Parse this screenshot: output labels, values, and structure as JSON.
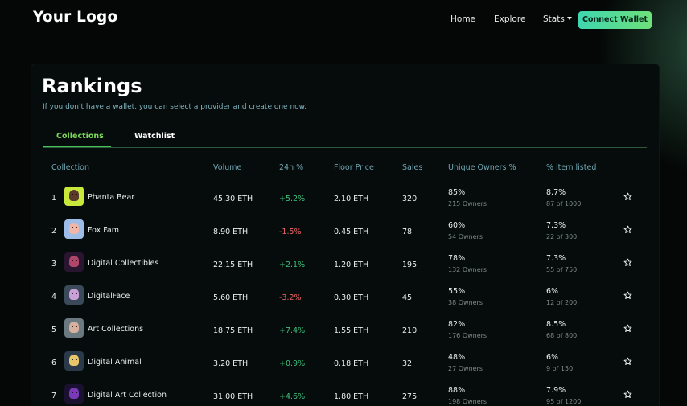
{
  "header": {
    "logo": "Your Logo",
    "nav": {
      "home": "Home",
      "explore": "Explore",
      "stats": "Stats"
    },
    "connect_button": "Connect Wallet"
  },
  "main": {
    "title": "Rankings",
    "subtitle": "If you don't have a wallet, you can select a provider and create one now.",
    "tabs": [
      {
        "label": "Collections",
        "active": true
      },
      {
        "label": "Watchlist",
        "active": false
      }
    ],
    "columns": {
      "collection": "Collection",
      "volume": "Volume",
      "change": "24h %",
      "floor": "Floor Price",
      "sales": "Sales",
      "owners": "Unique Owners %",
      "listed": "% item listed"
    },
    "rows": [
      {
        "rank": "1",
        "name": "Phanta Bear",
        "volume": "45.30 ETH",
        "change": "+5.2%",
        "trend": "up",
        "floor": "2.10 ETH",
        "sales": "320",
        "owners_pct": "85%",
        "owners_sub": "215 Owners",
        "listed_pct": "8.7%",
        "listed_sub": "87 of 1000",
        "thumb_bg": "#c8e83c",
        "thumb_fg": "#5a3a2a",
        "icon": "star-outline-icon"
      },
      {
        "rank": "2",
        "name": "Fox Fam",
        "volume": "8.90 ETH",
        "change": "-1.5%",
        "trend": "down",
        "floor": "0.45 ETH",
        "sales": "78",
        "owners_pct": "60%",
        "owners_sub": "54 Owners",
        "listed_pct": "7.3%",
        "listed_sub": "22 of 300",
        "thumb_bg": "#9dbde8",
        "thumb_fg": "#f2b6a8",
        "icon": "star-outline-icon"
      },
      {
        "rank": "3",
        "name": "Digital Collectibles",
        "volume": "22.15 ETH",
        "change": "+2.1%",
        "trend": "up",
        "floor": "1.20 ETH",
        "sales": "195",
        "owners_pct": "78%",
        "owners_sub": "132 Owners",
        "listed_pct": "7.3%",
        "listed_sub": "55 of 750",
        "thumb_bg": "#2a1530",
        "thumb_fg": "#b0476a",
        "icon": "star-outline-icon"
      },
      {
        "rank": "4",
        "name": "DigitalFace",
        "volume": "5.60 ETH",
        "change": "-3.2%",
        "trend": "down",
        "floor": "0.30 ETH",
        "sales": "45",
        "owners_pct": "55%",
        "owners_sub": "38 Owners",
        "listed_pct": "6%",
        "listed_sub": "12 of 200",
        "thumb_bg": "#3a4a5a",
        "thumb_fg": "#c9a0d8",
        "icon": "star-outline-icon"
      },
      {
        "rank": "5",
        "name": "Art Collections",
        "volume": "18.75 ETH",
        "change": "+7.4%",
        "trend": "up",
        "floor": "1.55 ETH",
        "sales": "210",
        "owners_pct": "82%",
        "owners_sub": "176 Owners",
        "listed_pct": "8.5%",
        "listed_sub": "68 of 800",
        "thumb_bg": "#6a7a80",
        "thumb_fg": "#d8b0a0",
        "icon": "star-outline-icon"
      },
      {
        "rank": "6",
        "name": "Digital Animal",
        "volume": "3.20 ETH",
        "change": "+0.9%",
        "trend": "up",
        "floor": "0.18 ETH",
        "sales": "32",
        "owners_pct": "48%",
        "owners_sub": "27 Owners",
        "listed_pct": "6%",
        "listed_sub": "9 of 150",
        "thumb_bg": "#2a3a4a",
        "thumb_fg": "#e8c46a",
        "icon": "star-outline-icon"
      },
      {
        "rank": "7",
        "name": "Digital Art Collection",
        "volume": "31.00 ETH",
        "change": "+4.6%",
        "trend": "up",
        "floor": "1.80 ETH",
        "sales": "275",
        "owners_pct": "88%",
        "owners_sub": "198 Owners",
        "listed_pct": "7.9%",
        "listed_sub": "95 of 1200",
        "thumb_bg": "#1a1030",
        "thumb_fg": "#7a3ab8",
        "icon": "star-outline-icon"
      }
    ]
  },
  "colors": {
    "accent": "#48c15a",
    "button_gradient_start": "#3fd6b0",
    "button_gradient_end": "#6de07a",
    "positive": "#3ec07c",
    "negative": "#f06466",
    "header_text": "#6fa6b4"
  }
}
